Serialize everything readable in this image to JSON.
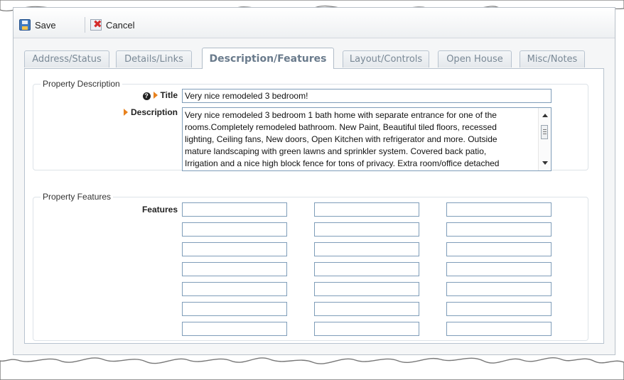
{
  "toolbar": {
    "save_label": "Save",
    "cancel_label": "Cancel"
  },
  "tabs": [
    {
      "label": "Address/Status",
      "active": false
    },
    {
      "label": "Details/Links",
      "active": false
    },
    {
      "label": "Description/Features",
      "active": true
    },
    {
      "label": "Layout/Controls",
      "active": false
    },
    {
      "label": "Open House",
      "active": false
    },
    {
      "label": "Misc/Notes",
      "active": false
    }
  ],
  "description_section": {
    "legend": "Property Description",
    "title_label": "Title",
    "title_value": "Very nice remodeled 3 bedroom!",
    "description_label": "Description",
    "description_lines": [
      "Very nice remodeled 3 bedroom 1 bath home with separate entrance for one of the",
      "rooms.Completely remodeled bathroom. New Paint, Beautiful tiled floors, recessed",
      "lighting, Ceiling fans, New doors, Open Kitchen with refrigerator and more. Outside",
      "mature landscaping with green lawns and sprinkler system. Covered back patio,",
      "Irrigation and a nice high block fence for tons of privacy. Extra room/office detached"
    ]
  },
  "features_section": {
    "legend": "Property Features",
    "features_label": "Features",
    "feature_values": [
      "",
      "",
      "",
      "",
      "",
      "",
      "",
      "",
      "",
      "",
      "",
      "",
      "",
      "",
      "",
      "",
      "",
      "",
      "",
      "",
      ""
    ]
  },
  "icons": {
    "save": "save-disk-icon",
    "cancel": "cancel-x-icon",
    "help": "help-icon",
    "required": "required-arrow-icon"
  },
  "colors": {
    "arrow": "#e8821e",
    "input_border": "#7f9db9",
    "tab_text": "#7a8996"
  }
}
